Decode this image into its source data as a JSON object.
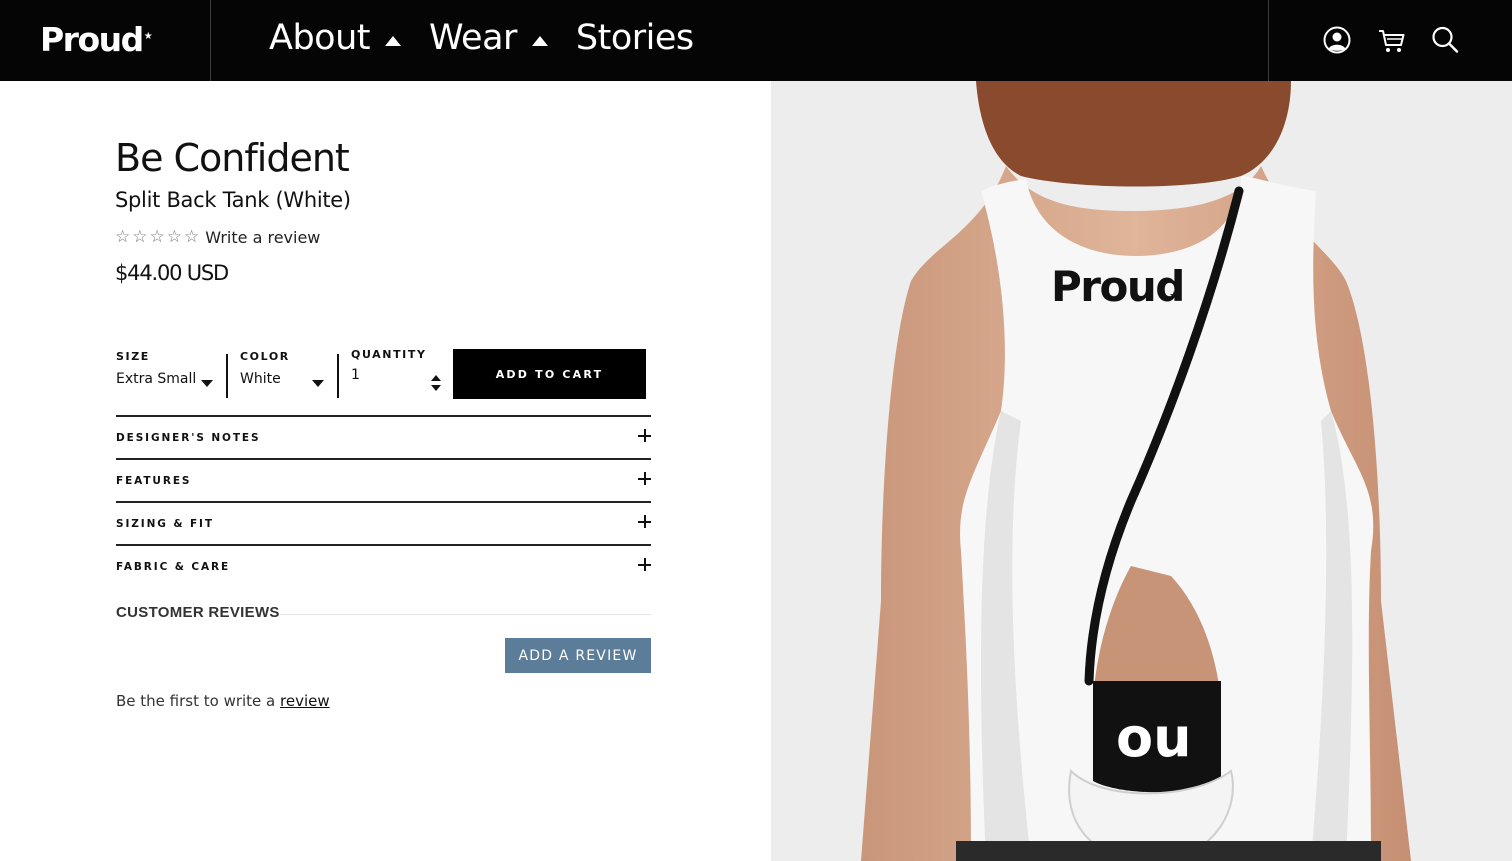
{
  "header": {
    "logo": "Proud",
    "logo_mark": "★",
    "nav": [
      {
        "label": "About",
        "has_dropdown": true
      },
      {
        "label": "Wear",
        "has_dropdown": true
      },
      {
        "label": "Stories",
        "has_dropdown": false
      }
    ],
    "icons": [
      "account-icon",
      "cart-icon",
      "search-icon"
    ]
  },
  "product": {
    "title": "Be Confident",
    "subtitle": "Split Back Tank (White)",
    "rating_stars": 0,
    "rating_max": 5,
    "write_review": "Write a review",
    "price": "$44.00 USD"
  },
  "options": {
    "size": {
      "label": "SIZE",
      "value": "Extra Small"
    },
    "color": {
      "label": "COLOR",
      "value": "White"
    },
    "quantity": {
      "label": "QUANTITY",
      "value": "1"
    },
    "add_to_cart": "ADD TO CART"
  },
  "accordion": [
    {
      "label": "DESIGNER'S NOTES"
    },
    {
      "label": "FEATURES"
    },
    {
      "label": "SIZING & FIT"
    },
    {
      "label": "FABRIC & CARE"
    }
  ],
  "reviews": {
    "title": "CUSTOMER REVIEWS",
    "add_button": "ADD A REVIEW",
    "empty_prefix": "Be the first to write a ",
    "empty_link": "review"
  },
  "photo": {
    "shirt_logo": "Proud",
    "shirt_logo_mark": "★",
    "inner_logo": "ou"
  },
  "colors": {
    "header_bg": "#050505",
    "cart_button": "#000000",
    "review_button": "#5c7d99",
    "photo_bg": "#ececec"
  }
}
